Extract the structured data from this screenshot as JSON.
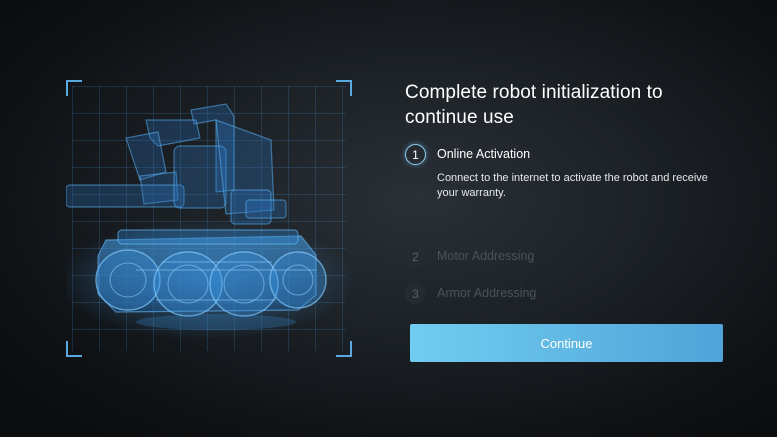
{
  "heading": "Complete robot initialization to continue use",
  "steps": [
    {
      "number": "1",
      "title": "Online Activation",
      "description": "Connect to the internet to activate the robot and receive your warranty.",
      "state": "active"
    },
    {
      "number": "2",
      "title": "Motor Addressing",
      "state": "inactive"
    },
    {
      "number": "3",
      "title": "Armor Addressing",
      "state": "inactive"
    }
  ],
  "continue_label": "Continue",
  "colors": {
    "accent": "#5aa8e0",
    "button_start": "#71cdef",
    "button_end": "#4fa3d9",
    "inactive_text": "#4c5257"
  },
  "image": {
    "subject": "robot-xray-wireframe"
  }
}
